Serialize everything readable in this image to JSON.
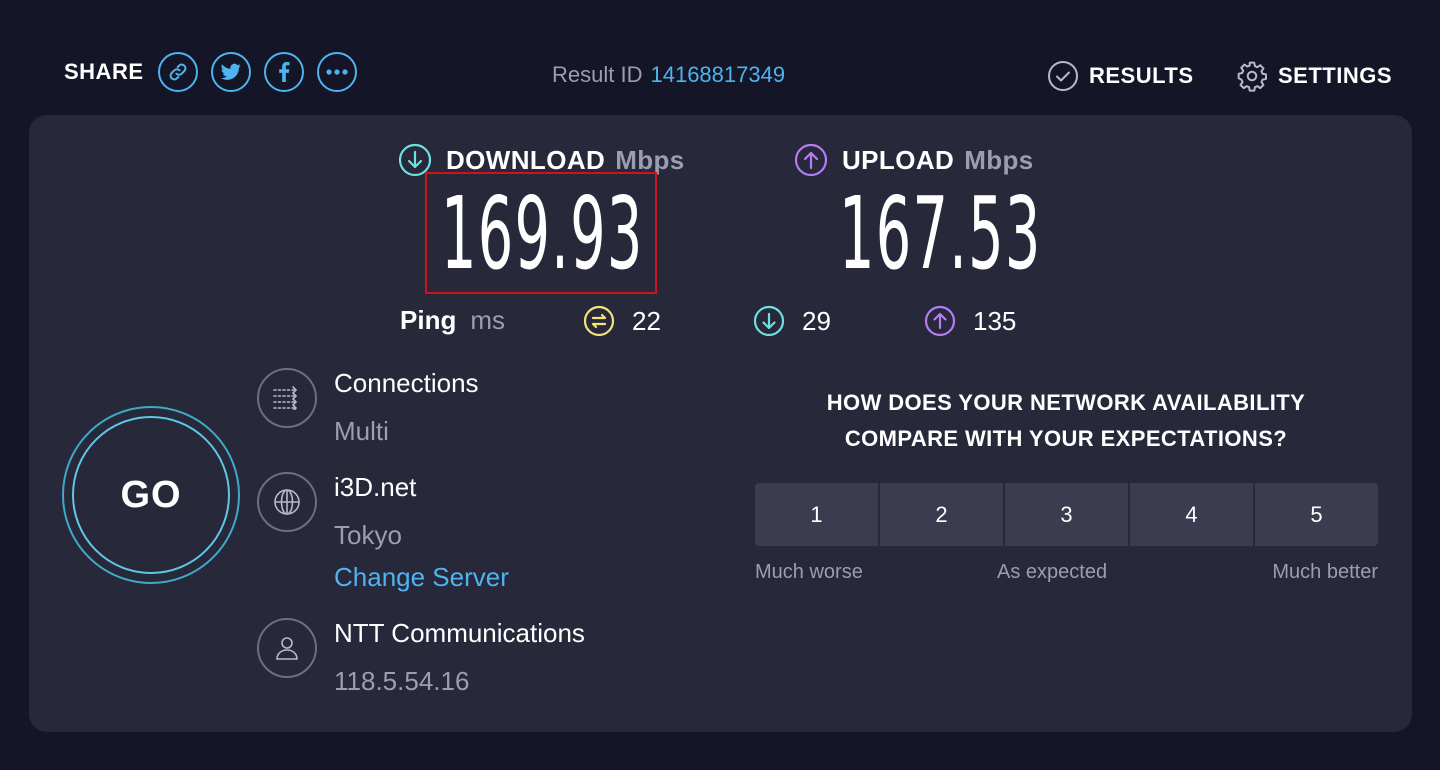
{
  "header": {
    "share_label": "SHARE",
    "share_buttons": [
      {
        "icon": "link-icon"
      },
      {
        "icon": "twitter-icon"
      },
      {
        "icon": "facebook-icon"
      },
      {
        "icon": "more-icon"
      }
    ],
    "result_id_label": "Result ID",
    "result_id_value": "14168817349",
    "results_label": "RESULTS",
    "settings_label": "SETTINGS"
  },
  "download": {
    "label": "DOWNLOAD",
    "unit": "Mbps",
    "value": "169.93",
    "color": "#6ee0df"
  },
  "upload": {
    "label": "UPLOAD",
    "unit": "Mbps",
    "value": "167.53",
    "color": "#b57cf5"
  },
  "ping": {
    "label": "Ping",
    "unit": "ms",
    "idle": "22",
    "download": "29",
    "upload": "135",
    "idle_color": "#f5e27a"
  },
  "go_label": "GO",
  "connections": {
    "label": "Connections",
    "value": "Multi"
  },
  "server": {
    "name": "i3D.net",
    "location": "Tokyo",
    "change_label": "Change Server"
  },
  "isp": {
    "name": "NTT Communications",
    "ip": "118.5.54.16"
  },
  "survey": {
    "question_line1": "HOW DOES YOUR NETWORK AVAILABILITY",
    "question_line2": "COMPARE WITH YOUR EXPECTATIONS?",
    "options": [
      "1",
      "2",
      "3",
      "4",
      "5"
    ],
    "low_label": "Much worse",
    "mid_label": "As expected",
    "high_label": "Much better"
  },
  "colors": {
    "background": "#141526",
    "card": "#272839",
    "accent_blue": "#4fb3f0",
    "highlight_red": "#d0131a"
  }
}
